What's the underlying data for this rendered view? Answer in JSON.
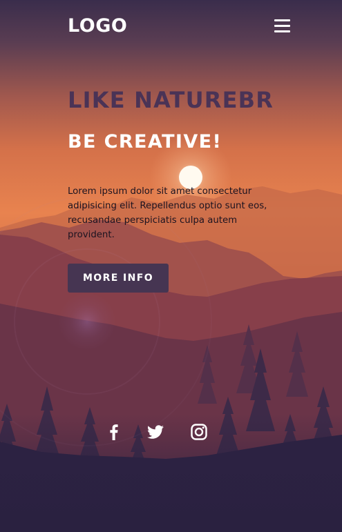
{
  "header": {
    "logo_text": "LOGO",
    "menu_icon": "hamburger-menu-icon"
  },
  "hero": {
    "title": "LIKE NATUREBR",
    "subtitle": "BE CREATIVE!",
    "description": "Lorem ipsum dolor sit amet consectetur adipisicing elit. Repellendus optio sunt eos, recusandae perspiciatis culpa autem provident.",
    "cta_label": "MORE INFO"
  },
  "social": {
    "icons": [
      "facebook-icon",
      "twitter-icon",
      "instagram-icon"
    ]
  },
  "colors": {
    "sky_top": "#3b2d4b",
    "sky_glow": "#e07a48",
    "title": "#4a3356",
    "button_bg": "#463552",
    "foreground_dark": "#2a2140"
  }
}
